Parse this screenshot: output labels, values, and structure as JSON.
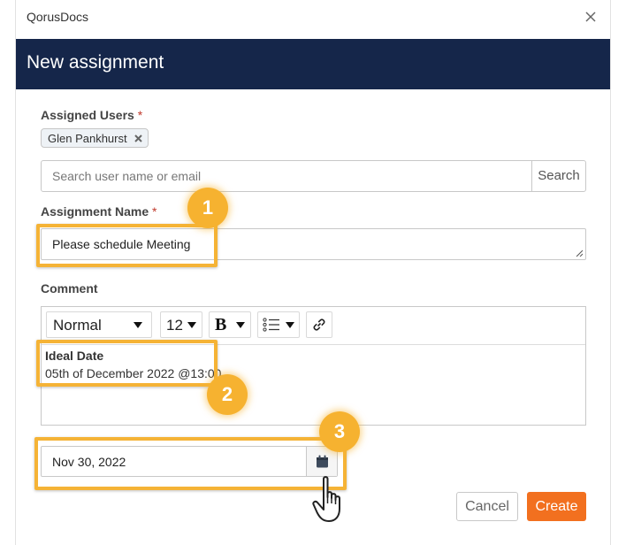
{
  "window": {
    "app_name": "QorusDocs",
    "close_icon": "close-icon"
  },
  "dialog": {
    "title": "New assignment",
    "header_color": "#15264a",
    "assigned_users": {
      "label": "Assigned Users",
      "required_mark": "*",
      "chips": [
        {
          "name": "Glen Pankhurst",
          "remove_icon": "close-icon"
        }
      ],
      "search_placeholder": "Search user name or email",
      "search_button": "Search"
    },
    "assignment_name": {
      "label": "Assignment Name",
      "required_mark": "*",
      "value": "Please schedule Meeting"
    },
    "comment": {
      "label": "Comment",
      "toolbar": {
        "style": "Normal",
        "size": "12",
        "bold": "B",
        "list_icon": "list-icon",
        "link_icon": "link-icon"
      },
      "body": {
        "title": "Ideal Date",
        "text": "05th of December 2022 @13:00"
      }
    },
    "due_date": {
      "value": "Nov 30, 2022",
      "calendar_icon": "calendar-icon"
    },
    "buttons": {
      "cancel": "Cancel",
      "create": "Create",
      "create_color": "#f2701f"
    }
  },
  "annotations": {
    "color": "#f6b230",
    "markers": [
      "1",
      "2",
      "3"
    ],
    "pointer_icon": "hand-pointer-icon"
  }
}
